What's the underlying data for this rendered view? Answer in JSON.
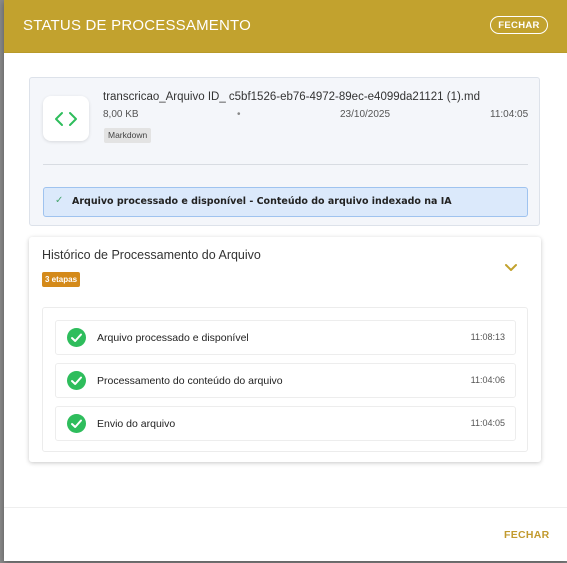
{
  "dialog": {
    "title": "STATUS DE PROCESSAMENTO",
    "header_close_label": "FECHAR",
    "footer_close_label": "FECHAR"
  },
  "file": {
    "icon": "code-icon",
    "name": "transcricao_Arquivo ID_ c5bf1526-eb76-4972-89ec-e4099da21121 (1).md",
    "size": "8,00 KB",
    "separator": "•",
    "date": "23/10/2025",
    "time": "11:04:05",
    "type_label": "Markdown",
    "status_check": "✓",
    "status_message": "Arquivo processado e disponível - Conteúdo do arquivo indexado na IA"
  },
  "history": {
    "title": "Histórico de Processamento do Arquivo",
    "steps_badge": "3 etapas",
    "steps": [
      {
        "label": "Arquivo processado e disponível",
        "time": "11:08:13",
        "icon": "check-circle-icon"
      },
      {
        "label": "Processamento do conteúdo do arquivo",
        "time": "11:04:06",
        "icon": "check-circle-icon"
      },
      {
        "label": "Envio do arquivo",
        "time": "11:04:05",
        "icon": "check-circle-icon"
      }
    ]
  },
  "colors": {
    "brand": "#c2a22e",
    "success": "#2ebd5c",
    "badge": "#d48a1a",
    "banner_bg": "#dbe9fb"
  }
}
